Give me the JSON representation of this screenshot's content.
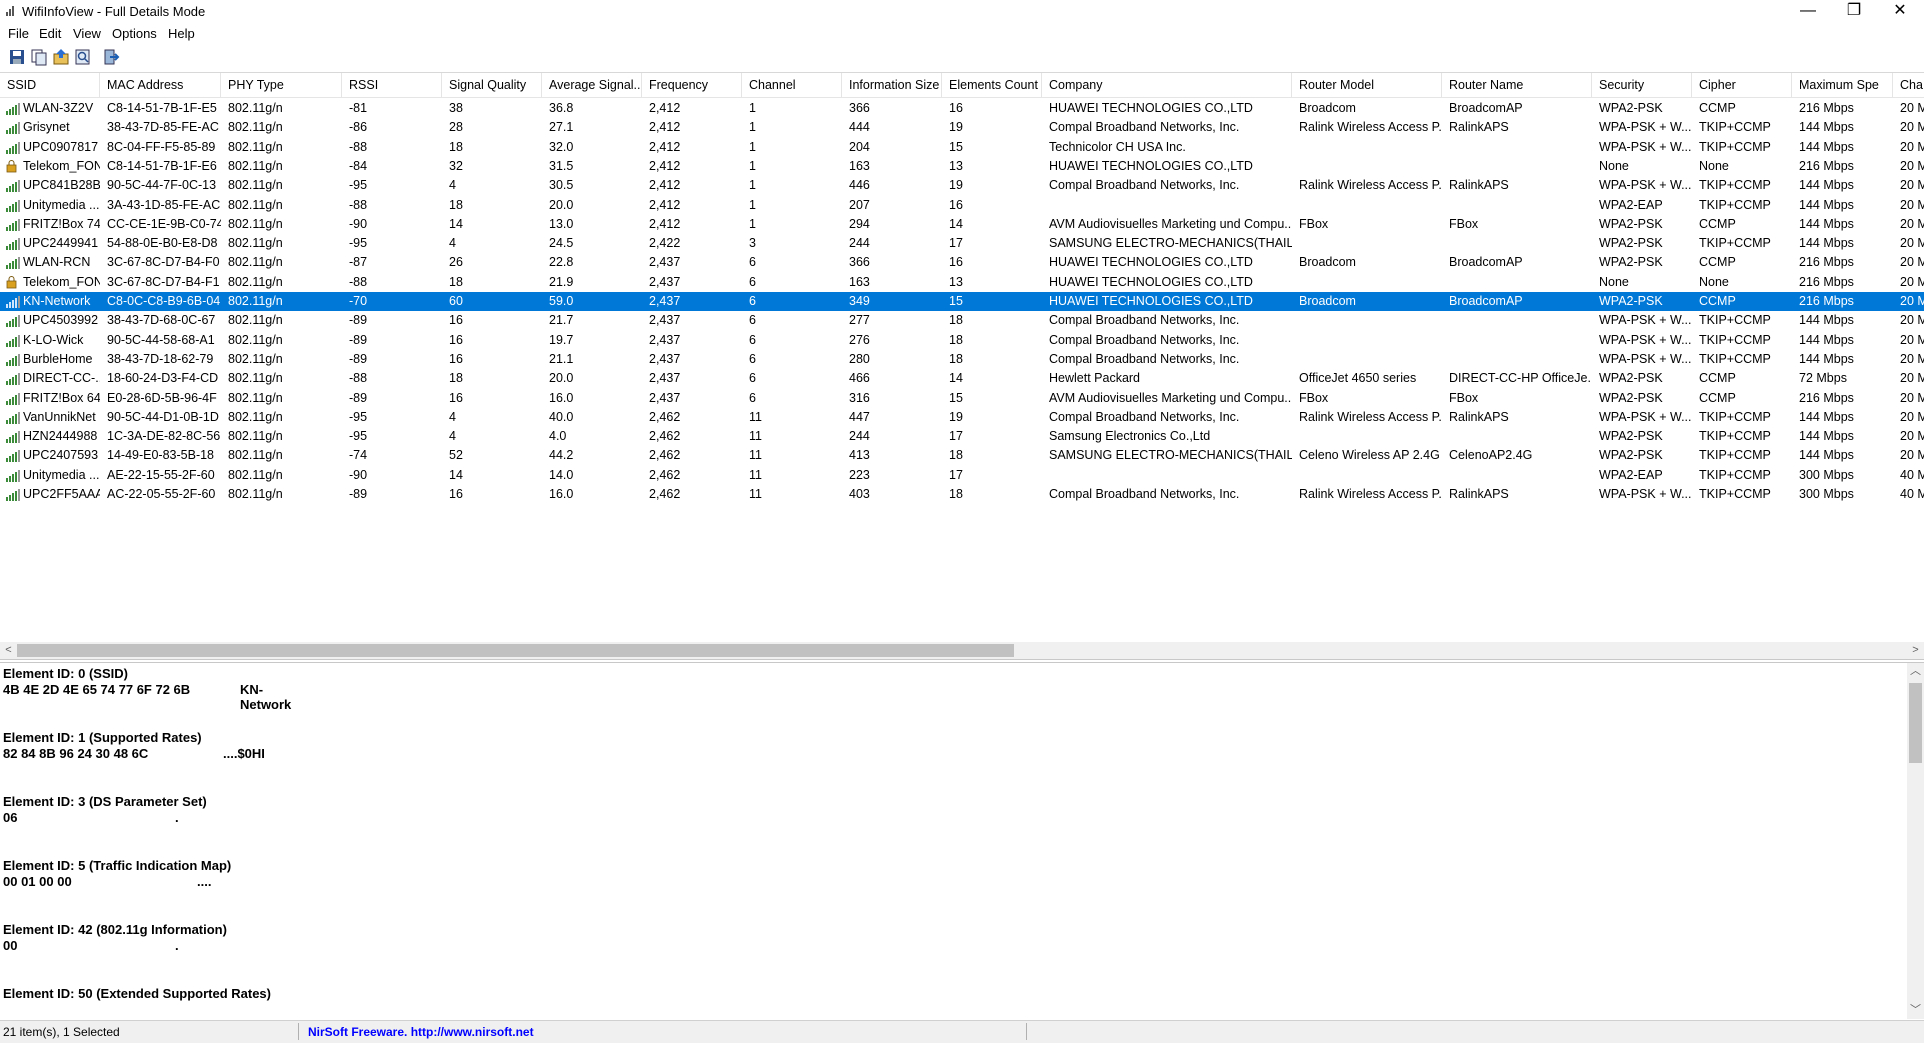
{
  "window": {
    "title": "WifiInfoView  - Full Details Mode",
    "minimize": "—",
    "restore": "❐",
    "close": "✕"
  },
  "menu": [
    "File",
    "Edit",
    "View",
    "Options",
    "Help"
  ],
  "toolbar": [
    "save-icon",
    "copy-icon",
    "export-icon",
    "find-icon",
    "exit-icon"
  ],
  "columns": [
    "SSID",
    "MAC Address",
    "PHY Type",
    "RSSI",
    "Signal Quality",
    "Average Signal...",
    "Frequency",
    "Channel",
    "Information Size",
    "Elements Count",
    "Company",
    "Router Model",
    "Router Name",
    "Security",
    "Cipher",
    "Maximum Spe",
    "Cha"
  ],
  "sort_indicator": "/",
  "rows": [
    [
      "WLAN-3Z2V",
      "C8-14-51-7B-1F-E5",
      "802.11g/n",
      "-81",
      "38",
      "36.8",
      "2,412",
      "1",
      "366",
      "16",
      "HUAWEI TECHNOLOGIES CO.,LTD",
      "Broadcom",
      "BroadcomAP",
      "WPA2-PSK",
      "CCMP",
      "216 Mbps",
      "20 M"
    ],
    [
      "Grisynet",
      "38-43-7D-85-FE-AC",
      "802.11g/n",
      "-86",
      "28",
      "27.1",
      "2,412",
      "1",
      "444",
      "19",
      "Compal Broadband Networks, Inc.",
      "Ralink Wireless Access P...",
      "RalinkAPS",
      "WPA-PSK + W...",
      "TKIP+CCMP",
      "144 Mbps",
      "20 M"
    ],
    [
      "UPC0907817",
      "8C-04-FF-F5-85-89",
      "802.11g/n",
      "-88",
      "18",
      "32.0",
      "2,412",
      "1",
      "204",
      "15",
      "Technicolor CH USA Inc.",
      "",
      "",
      "WPA-PSK + W...",
      "TKIP+CCMP",
      "144 Mbps",
      "20 M"
    ],
    [
      "Telekom_FON",
      "C8-14-51-7B-1F-E6",
      "802.11g/n",
      "-84",
      "32",
      "31.5",
      "2,412",
      "1",
      "163",
      "13",
      "HUAWEI TECHNOLOGIES CO.,LTD",
      "",
      "",
      "None",
      "None",
      "216 Mbps",
      "20 M"
    ],
    [
      "UPC841B28B",
      "90-5C-44-7F-0C-13",
      "802.11g/n",
      "-95",
      "4",
      "30.5",
      "2,412",
      "1",
      "446",
      "19",
      "Compal Broadband Networks, Inc.",
      "Ralink Wireless Access P...",
      "RalinkAPS",
      "WPA-PSK + W...",
      "TKIP+CCMP",
      "144 Mbps",
      "20 M"
    ],
    [
      "Unitymedia ...",
      "3A-43-1D-85-FE-AC",
      "802.11g/n",
      "-88",
      "18",
      "20.0",
      "2,412",
      "1",
      "207",
      "16",
      "",
      "",
      "",
      "WPA2-EAP",
      "TKIP+CCMP",
      "144 Mbps",
      "20 M"
    ],
    [
      "FRITZ!Box 74",
      "CC-CE-1E-9B-C0-74",
      "802.11g/n",
      "-90",
      "14",
      "13.0",
      "2,412",
      "1",
      "294",
      "14",
      "AVM Audiovisuelles Marketing und Compu...",
      "FBox",
      "FBox",
      "WPA2-PSK",
      "CCMP",
      "144 Mbps",
      "20 M"
    ],
    [
      "UPC2449941",
      "54-88-0E-B0-E8-D8",
      "802.11g/n",
      "-95",
      "4",
      "24.5",
      "2,422",
      "3",
      "244",
      "17",
      "SAMSUNG ELECTRO-MECHANICS(THAILA",
      "",
      "",
      "WPA2-PSK",
      "TKIP+CCMP",
      "144 Mbps",
      "20 M"
    ],
    [
      "WLAN-RCN",
      "3C-67-8C-D7-B4-F0",
      "802.11g/n",
      "-87",
      "26",
      "22.8",
      "2,437",
      "6",
      "366",
      "16",
      "HUAWEI TECHNOLOGIES CO.,LTD",
      "Broadcom",
      "BroadcomAP",
      "WPA2-PSK",
      "CCMP",
      "216 Mbps",
      "20 M"
    ],
    [
      "Telekom_FON",
      "3C-67-8C-D7-B4-F1",
      "802.11g/n",
      "-88",
      "18",
      "21.9",
      "2,437",
      "6",
      "163",
      "13",
      "HUAWEI TECHNOLOGIES CO.,LTD",
      "",
      "",
      "None",
      "None",
      "216 Mbps",
      "20 M"
    ],
    [
      "KN-Network",
      "C8-0C-C8-B9-6B-04",
      "802.11g/n",
      "-70",
      "60",
      "59.0",
      "2,437",
      "6",
      "349",
      "15",
      "HUAWEI TECHNOLOGIES CO.,LTD",
      "Broadcom",
      "BroadcomAP",
      "WPA2-PSK",
      "CCMP",
      "216 Mbps",
      "20 M"
    ],
    [
      "UPC4503992",
      "38-43-7D-68-0C-67",
      "802.11g/n",
      "-89",
      "16",
      "21.7",
      "2,437",
      "6",
      "277",
      "18",
      "Compal Broadband Networks, Inc.",
      "",
      "",
      "WPA-PSK + W...",
      "TKIP+CCMP",
      "144 Mbps",
      "20 M"
    ],
    [
      "K-LO-Wick",
      "90-5C-44-58-68-A1",
      "802.11g/n",
      "-89",
      "16",
      "19.7",
      "2,437",
      "6",
      "276",
      "18",
      "Compal Broadband Networks, Inc.",
      "",
      "",
      "WPA-PSK + W...",
      "TKIP+CCMP",
      "144 Mbps",
      "20 M"
    ],
    [
      "BurbleHome",
      "38-43-7D-18-62-79",
      "802.11g/n",
      "-89",
      "16",
      "21.1",
      "2,437",
      "6",
      "280",
      "18",
      "Compal Broadband Networks, Inc.",
      "",
      "",
      "WPA-PSK + W...",
      "TKIP+CCMP",
      "144 Mbps",
      "20 M"
    ],
    [
      "DIRECT-CC-...",
      "18-60-24-D3-F4-CD",
      "802.11g/n",
      "-88",
      "18",
      "20.0",
      "2,437",
      "6",
      "466",
      "14",
      "Hewlett Packard",
      "OfficeJet 4650 series",
      "DIRECT-CC-HP OfficeJe...",
      "WPA2-PSK",
      "CCMP",
      "72 Mbps",
      "20 M"
    ],
    [
      "FRITZ!Box 64...",
      "E0-28-6D-5B-96-4F",
      "802.11g/n",
      "-89",
      "16",
      "16.0",
      "2,437",
      "6",
      "316",
      "15",
      "AVM Audiovisuelles Marketing und Compu...",
      "FBox",
      "FBox",
      "WPA2-PSK",
      "CCMP",
      "216 Mbps",
      "20 M"
    ],
    [
      "VanUnnikNet",
      "90-5C-44-D1-0B-1D",
      "802.11g/n",
      "-95",
      "4",
      "40.0",
      "2,462",
      "11",
      "447",
      "19",
      "Compal Broadband Networks, Inc.",
      "Ralink Wireless Access P...",
      "RalinkAPS",
      "WPA-PSK + W...",
      "TKIP+CCMP",
      "144 Mbps",
      "20 M"
    ],
    [
      "HZN2444988",
      "1C-3A-DE-82-8C-56",
      "802.11g/n",
      "-95",
      "4",
      "4.0",
      "2,462",
      "11",
      "244",
      "17",
      "Samsung Electronics Co.,Ltd",
      "",
      "",
      "WPA2-PSK",
      "TKIP+CCMP",
      "144 Mbps",
      "20 M"
    ],
    [
      "UPC2407593",
      "14-49-E0-83-5B-18",
      "802.11g/n",
      "-74",
      "52",
      "44.2",
      "2,462",
      "11",
      "413",
      "18",
      "SAMSUNG ELECTRO-MECHANICS(THAILA",
      "Celeno Wireless AP 2.4G",
      "CelenoAP2.4G",
      "WPA2-PSK",
      "TKIP+CCMP",
      "144 Mbps",
      "20 M"
    ],
    [
      "Unitymedia ...",
      "AE-22-15-55-2F-60",
      "802.11g/n",
      "-90",
      "14",
      "14.0",
      "2,462",
      "11",
      "223",
      "17",
      "",
      "",
      "",
      "WPA2-EAP",
      "TKIP+CCMP",
      "300 Mbps",
      "40 M"
    ],
    [
      "UPC2FF5AAA",
      "AC-22-05-55-2F-60",
      "802.11g/n",
      "-89",
      "16",
      "16.0",
      "2,462",
      "11",
      "403",
      "18",
      "Compal Broadband Networks, Inc.",
      "Ralink Wireless Access P...",
      "RalinkAPS",
      "WPA-PSK + W...",
      "TKIP+CCMP",
      "300 Mbps",
      "40 M"
    ]
  ],
  "selected_row_index": 10,
  "lock_icon_rows": [
    3,
    9
  ],
  "elements": [
    {
      "title": "Element ID: 0  (SSID)",
      "hex": "4B 4E 2D 4E 65 74 77 6F 72 6B",
      "ascii": "KN-Network"
    },
    {
      "title": "Element ID: 1  (Supported Rates)",
      "hex": "82 84 8B 96 24 30 48 6C",
      "ascii": "....$0HI"
    },
    {
      "title": "Element ID: 3  (DS Parameter Set)",
      "hex": "06",
      "ascii": "."
    },
    {
      "title": "Element ID: 5  (Traffic Indication Map)",
      "hex": "00 01 00 00",
      "ascii": "...."
    },
    {
      "title": "Element ID: 42  (802.11g Information)",
      "hex": "00",
      "ascii": "."
    },
    {
      "title": "Element ID: 50  (Extended Supported Rates)",
      "hex": "",
      "ascii": ""
    }
  ],
  "status": {
    "items": "21 item(s), 1 Selected",
    "freeware": "NirSoft Freeware.  http://www.nirsoft.net"
  },
  "colors": {
    "selection": "#0078d7",
    "link": "#0000ff"
  }
}
